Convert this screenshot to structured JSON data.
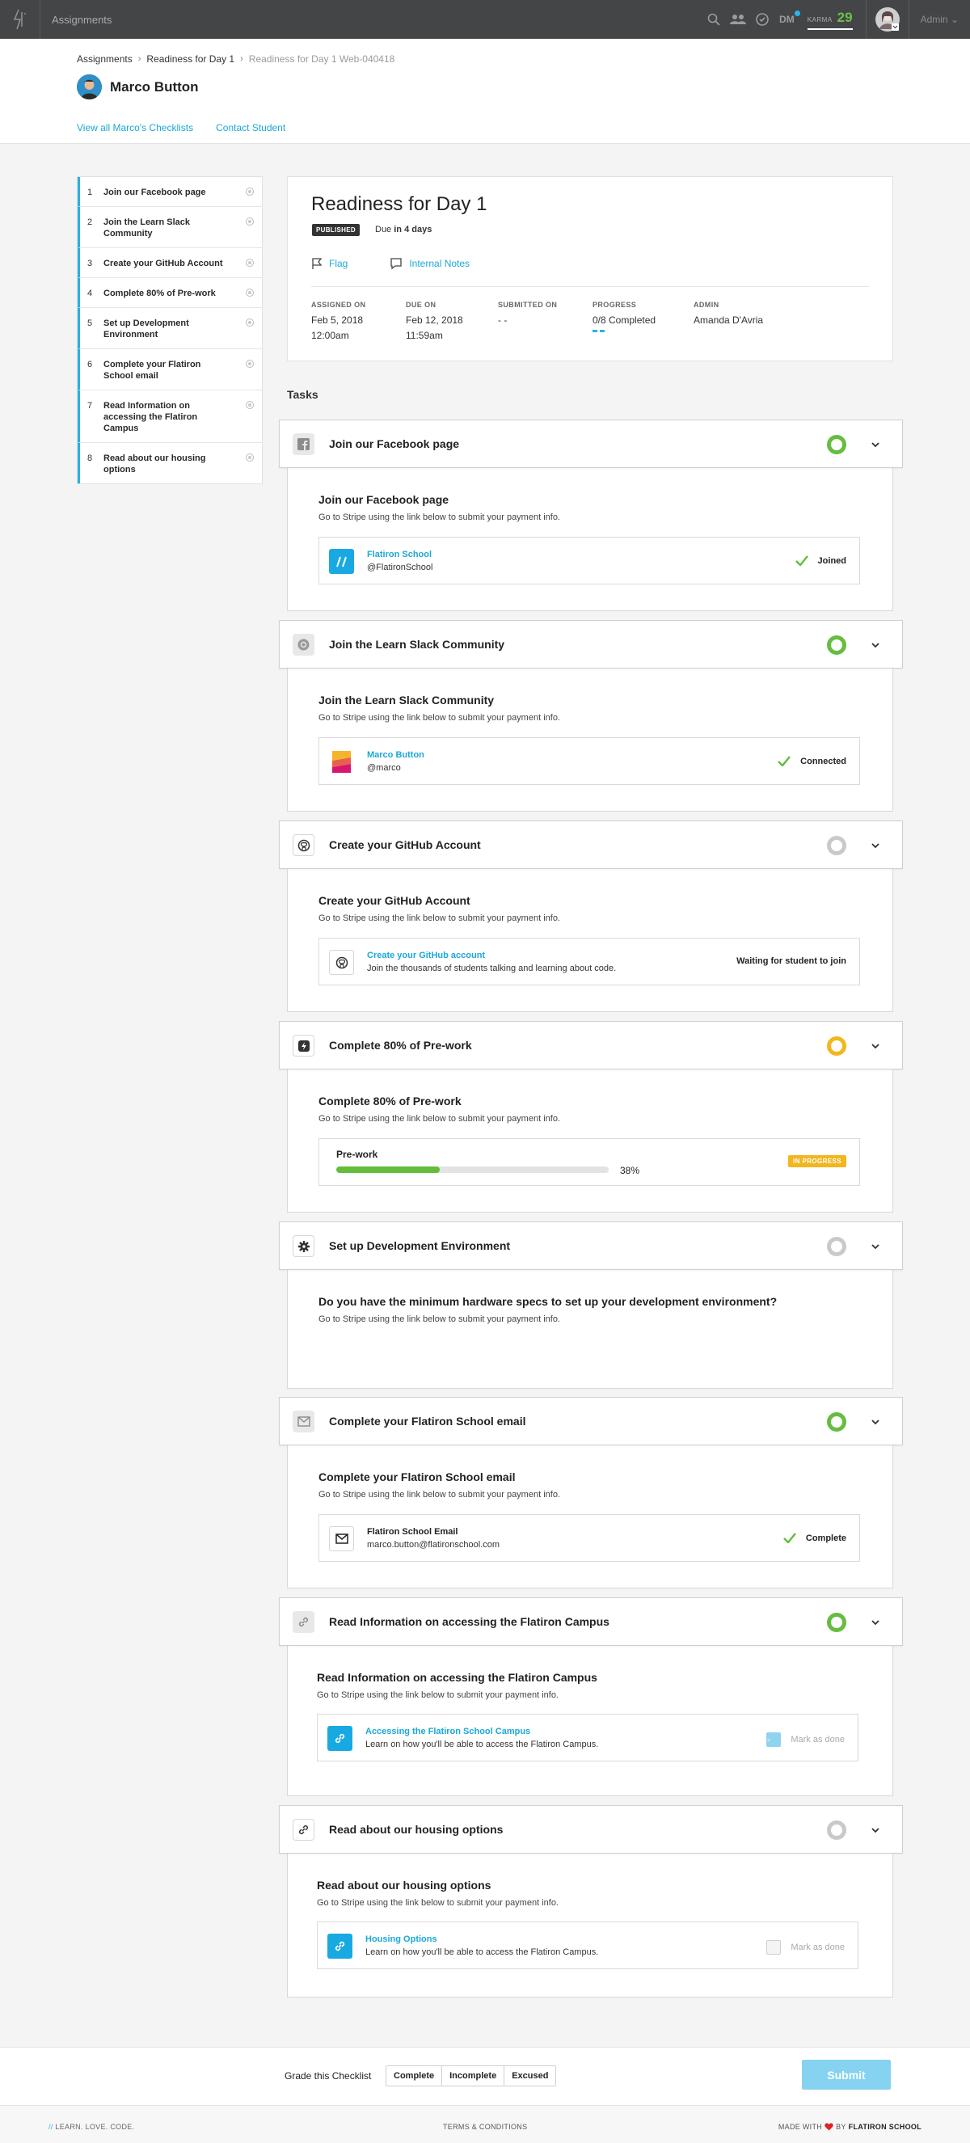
{
  "topbar": {
    "title": "Assignments",
    "dm_label": "DM",
    "karma_label": "KARMA",
    "karma_value": "29",
    "admin_label": "Admin"
  },
  "breadcrumb": {
    "items": [
      "Assignments",
      "Readiness for Day 1",
      "Readiness for Day 1 Web-040418"
    ]
  },
  "student": {
    "name": "Marco Button",
    "links": [
      "View all Marco's Checklists",
      "Contact Student"
    ]
  },
  "sidebar": {
    "items": [
      {
        "num": "1",
        "label": "Join our Facebook page"
      },
      {
        "num": "2",
        "label": "Join the Learn Slack Community"
      },
      {
        "num": "3",
        "label": "Create your GitHub Account"
      },
      {
        "num": "4",
        "label": "Complete 80% of Pre-work"
      },
      {
        "num": "5",
        "label": "Set up Development Environment"
      },
      {
        "num": "6",
        "label": "Complete your Flatiron School email"
      },
      {
        "num": "7",
        "label": "Read Information on accessing the Flatiron Campus"
      },
      {
        "num": "8",
        "label": "Read about our housing options"
      }
    ]
  },
  "checklist": {
    "title": "Readiness for Day 1",
    "status_badge": "PUBLISHED",
    "due_prefix": "Due",
    "due_value": "in 4 days",
    "flag_label": "Flag",
    "notes_label": "Internal Notes",
    "meta": {
      "assigned_label": "ASSIGNED ON",
      "assigned_date": "Feb 5, 2018",
      "assigned_time": "12:00am",
      "due_label": "DUE ON",
      "due_date": "Feb 12, 2018",
      "due_time": "11:59am",
      "submitted_label": "SUBMITTED ON",
      "submitted_value": "- -",
      "progress_label": "PROGRESS",
      "progress_value": "0/8 Completed",
      "admin_label": "ADMIN",
      "admin_value": "Amanda D'Avria"
    }
  },
  "tasks_heading": "Tasks",
  "tasks": [
    {
      "title": "Join our Facebook page",
      "status": "green",
      "body_title": "Join our Facebook page",
      "body_sub": "Go to Stripe using the link below to submit your payment info.",
      "card_title": "Flatiron School",
      "card_sub": "@FlatironSchool",
      "card_status": "Joined",
      "card_icon": "flatiron-logo-icon"
    },
    {
      "title": "Join the Learn Slack Community",
      "status": "green",
      "body_title": "Join the Learn Slack Community",
      "body_sub": "Go to Stripe using the link below to submit your payment info.",
      "card_title": "Marco Button",
      "card_sub": "@marco",
      "card_status": "Connected",
      "card_icon": "learn-slack-icon"
    },
    {
      "title": "Create your GitHub Account",
      "status": "grey",
      "body_title": "Create your GitHub Account",
      "body_sub": "Go to Stripe using the link below to submit your payment info.",
      "card_title": "Create your GitHub account",
      "card_sub": "Join the thousands of students talking and learning about code.",
      "card_status": "Waiting for student to join",
      "card_icon": "github-icon"
    },
    {
      "title": "Complete 80% of Pre-work",
      "status": "yellow",
      "body_title": "Complete 80% of Pre-work",
      "body_sub": "Go to Stripe using the link below to submit your payment info.",
      "prework_label": "Pre-work",
      "prework_progress": 0.38,
      "prework_pct": "38%",
      "prework_badge": "IN PROGRESS"
    },
    {
      "title": "Set up Development Environment",
      "status": "grey",
      "body_title": "Do you have the minimum hardware specs to set up your development environment?",
      "body_sub": "Go to Stripe using the link below to submit your payment info."
    },
    {
      "title": "Complete your Flatiron School email",
      "status": "green",
      "body_title": "Complete your Flatiron School email",
      "body_sub": "Go to Stripe using the link below to submit your payment info.",
      "card_title": "Flatiron School Email",
      "card_sub": "marco.button@flatironschool.com",
      "card_status": "Complete",
      "card_icon": "mail-icon"
    },
    {
      "title": "Read Information on accessing the Flatiron Campus",
      "status": "green",
      "body_title": "Read Information on accessing the Flatiron Campus",
      "body_sub": "Go to Stripe using the link below to submit your payment info.",
      "card_title": "Accessing the Flatiron School Campus",
      "card_sub": "Learn on how you'll be able to access the Flatiron Campus.",
      "card_status": "Mark as done",
      "checked": true,
      "card_icon": "link-icon"
    },
    {
      "title": "Read about our housing options",
      "status": "grey",
      "body_title": "Read about our housing options",
      "body_sub": "Go to Stripe using the link below to submit your payment info.",
      "card_title": "Housing Options",
      "card_sub": "Learn on how you'll be able to access the Flatiron Campus.",
      "card_status": "Mark as done",
      "checked": false,
      "card_icon": "link-icon"
    }
  ],
  "grade": {
    "label": "Grade this Checklist",
    "options": [
      "Complete",
      "Incomplete",
      "Excused"
    ],
    "submit": "Submit"
  },
  "footer": {
    "left_prefix": "//",
    "left": "LEARN. LOVE. CODE.",
    "middle": "TERMS & CONDITIONS",
    "right_prefix": "MADE WITH",
    "right_suffix": "BY",
    "right_brand": "FLATIRON SCHOOL"
  },
  "colors": {
    "accent": "#1ba8d8",
    "success": "#66bd3f",
    "warning": "#f3b71d",
    "topbar": "#444547"
  }
}
